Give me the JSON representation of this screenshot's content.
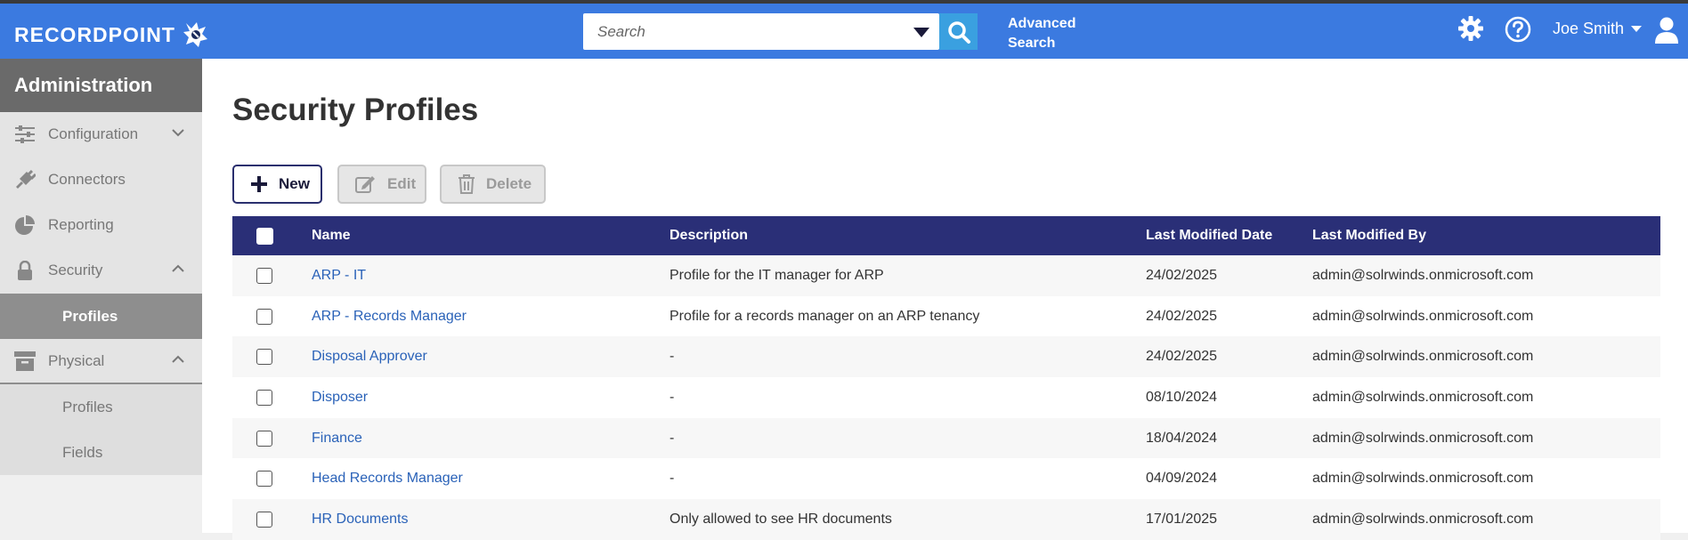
{
  "app": {
    "logo_text": "RECORDPOINT"
  },
  "header": {
    "search_placeholder": "Search",
    "advanced_search_line1": "Advanced",
    "advanced_search_line2": "Search",
    "user_name": "Joe Smith"
  },
  "sidebar": {
    "title": "Administration",
    "items": [
      {
        "label": "Configuration",
        "icon": "sliders-icon",
        "chevron": "down"
      },
      {
        "label": "Connectors",
        "icon": "plug-icon"
      },
      {
        "label": "Reporting",
        "icon": "pie-chart-icon"
      },
      {
        "label": "Security",
        "icon": "lock-icon",
        "chevron": "up"
      },
      {
        "label": "Profiles",
        "active": true
      },
      {
        "label": "Physical",
        "icon": "archive-box-icon",
        "chevron": "up"
      },
      {
        "label": "Profiles"
      },
      {
        "label": "Fields"
      }
    ]
  },
  "main": {
    "title": "Security Profiles",
    "toolbar": {
      "new_label": "New",
      "edit_label": "Edit",
      "delete_label": "Delete"
    },
    "table": {
      "columns": [
        "Name",
        "Description",
        "Last Modified Date",
        "Last Modified By"
      ],
      "rows": [
        {
          "name": "ARP - IT",
          "description": "Profile for the IT manager for ARP",
          "date": "24/02/2025",
          "by": "admin@solrwinds.onmicrosoft.com"
        },
        {
          "name": "ARP - Records Manager",
          "description": "Profile for a records manager on an ARP tenancy",
          "date": "24/02/2025",
          "by": "admin@solrwinds.onmicrosoft.com"
        },
        {
          "name": "Disposal Approver",
          "description": "-",
          "date": "24/02/2025",
          "by": "admin@solrwinds.onmicrosoft.com"
        },
        {
          "name": "Disposer",
          "description": "-",
          "date": "08/10/2024",
          "by": "admin@solrwinds.onmicrosoft.com"
        },
        {
          "name": "Finance",
          "description": "-",
          "date": "18/04/2024",
          "by": "admin@solrwinds.onmicrosoft.com"
        },
        {
          "name": "Head Records Manager",
          "description": "-",
          "date": "04/09/2024",
          "by": "admin@solrwinds.onmicrosoft.com"
        },
        {
          "name": "HR Documents",
          "description": "Only allowed to see HR documents",
          "date": "17/01/2025",
          "by": "admin@solrwinds.onmicrosoft.com"
        }
      ]
    }
  },
  "colors": {
    "header_bg": "#3b7ae0",
    "table_header_bg": "#2a2f77",
    "link": "#2a62b8",
    "sidebar_active": "#8e8e8e"
  }
}
